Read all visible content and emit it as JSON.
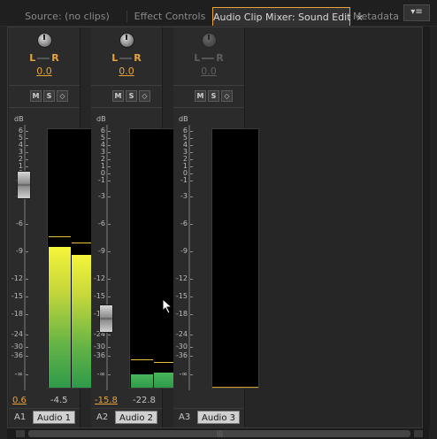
{
  "tabs": [
    {
      "label": "Source: (no clips)",
      "active": false
    },
    {
      "label": "Effect Controls",
      "active": false
    },
    {
      "label": "Audio Clip Mixer: Sound Edit",
      "active": true,
      "close": "×"
    },
    {
      "label": "Metadata",
      "active": false
    }
  ],
  "panel_menu_icon": "panel-menu-icon",
  "channels": [
    {
      "id": "A1",
      "name": "Audio 1",
      "pan": {
        "left": "L",
        "right": "R",
        "value": "0.0"
      },
      "buttons": {
        "mute": "M",
        "solo": "S",
        "record": "◇"
      },
      "db_label": "dB",
      "ticks": [
        "6",
        "5",
        "4",
        "3",
        "2",
        "1",
        "0",
        "-1",
        "-3",
        "-6",
        "-9",
        "-12",
        "-15",
        "-18",
        "-24",
        "-30",
        "-36",
        "-∞"
      ],
      "volume": "0.6",
      "meter_value": "-4.5",
      "meter_level_db": -4.5,
      "enabled": true
    },
    {
      "id": "A2",
      "name": "Audio 2",
      "pan": {
        "left": "L",
        "right": "R",
        "value": "0.0"
      },
      "buttons": {
        "mute": "M",
        "solo": "S",
        "record": "◇"
      },
      "db_label": "dB",
      "ticks": [
        "6",
        "5",
        "4",
        "3",
        "2",
        "1",
        "0",
        "-1",
        "-3",
        "-6",
        "-9",
        "-12",
        "-15",
        "-18",
        "-24",
        "-30",
        "-36",
        "-∞"
      ],
      "volume": "-15.8",
      "meter_value": "-22.8",
      "meter_level_db": -22.8,
      "enabled": true
    },
    {
      "id": "A3",
      "name": "Audio 3",
      "pan": {
        "left": "L",
        "right": "R",
        "value": "0.0"
      },
      "buttons": {
        "mute": "M",
        "solo": "S",
        "record": "◇"
      },
      "db_label": "dB",
      "ticks": [
        "6",
        "5",
        "4",
        "3",
        "2",
        "1",
        "0",
        "-1",
        "-3",
        "-6",
        "-9",
        "-12",
        "-15",
        "-18",
        "-24",
        "-30",
        "-36",
        "-∞"
      ],
      "volume": "",
      "meter_value": "",
      "meter_level_db": null,
      "enabled": false
    }
  ],
  "colors": {
    "accent": "#e8a33d",
    "meter_top": "#f5f53a",
    "meter_bottom": "#2e9a4a"
  }
}
